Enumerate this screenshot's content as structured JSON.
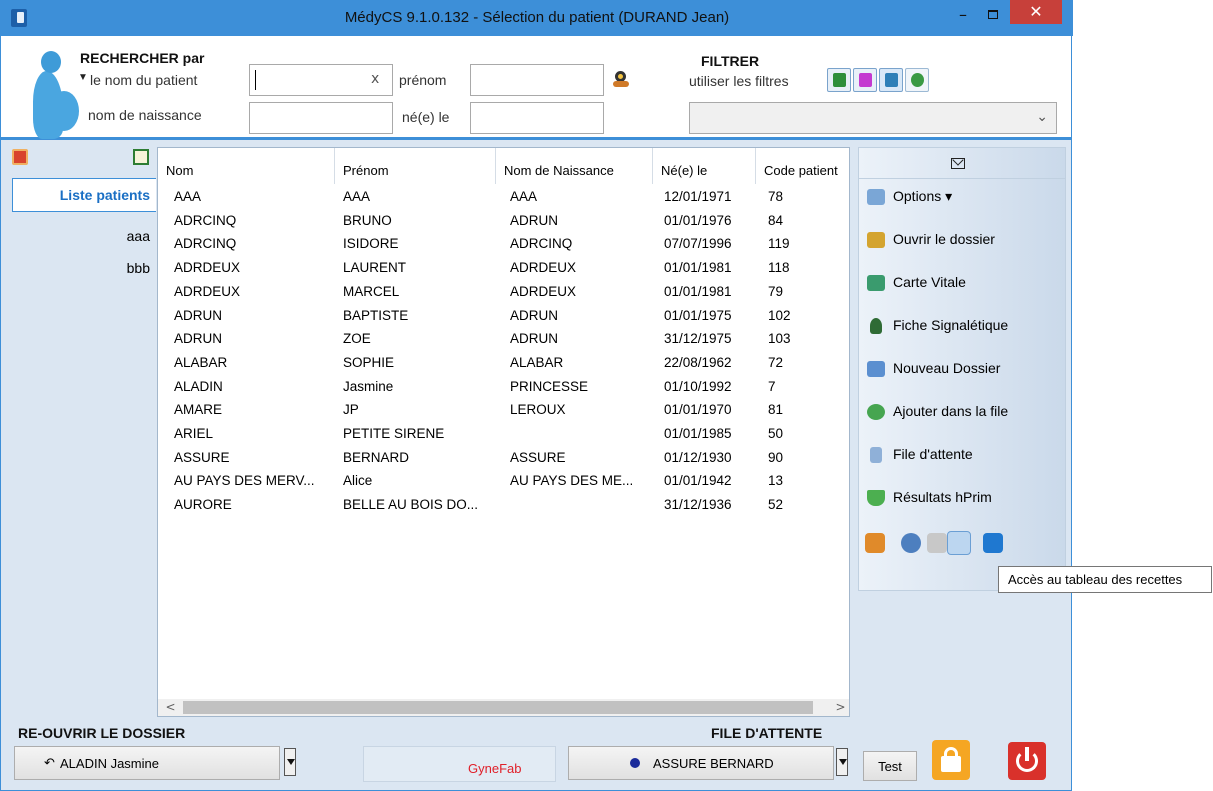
{
  "window": {
    "title": "MédyCS 9.1.0.132 - Sélection du patient (DURAND Jean)",
    "min": "–",
    "close": "✕"
  },
  "search": {
    "title": "RECHERCHER par",
    "mode": "le nom du patient",
    "clear": "x",
    "prenom_label": "prénom",
    "birthname_label": "nom de naissance",
    "born_label": "né(e) le",
    "name_value": "",
    "prenom_value": "",
    "birthname_value": "",
    "born_value": ""
  },
  "filter": {
    "title": "FILTRER",
    "subtitle": "utiliser les filtres",
    "select_value": ""
  },
  "sidebar": {
    "items": [
      {
        "label": "Liste patients"
      },
      {
        "label": "aaa"
      },
      {
        "label": "bbb"
      }
    ]
  },
  "grid": {
    "columns": [
      "Nom",
      "Prénom",
      "Nom de Naissance",
      "Né(e) le",
      "Code patient"
    ],
    "rows": [
      [
        "AAA",
        "AAA",
        "AAA",
        "12/01/1971",
        "78"
      ],
      [
        "ADRCINQ",
        "BRUNO",
        "ADRUN",
        "01/01/1976",
        "84"
      ],
      [
        "ADRCINQ",
        "ISIDORE",
        "ADRCINQ",
        "07/07/1996",
        "119"
      ],
      [
        "ADRDEUX",
        "LAURENT",
        "ADRDEUX",
        "01/01/1981",
        "118"
      ],
      [
        "ADRDEUX",
        "MARCEL",
        "ADRDEUX",
        "01/01/1981",
        "79"
      ],
      [
        "ADRUN",
        "BAPTISTE",
        "ADRUN",
        "01/01/1975",
        "102"
      ],
      [
        "ADRUN",
        "ZOE",
        "ADRUN",
        "31/12/1975",
        "103"
      ],
      [
        "ALABAR",
        "SOPHIE",
        "ALABAR",
        "22/08/1962",
        "72"
      ],
      [
        "ALADIN",
        "Jasmine",
        "PRINCESSE",
        "01/10/1992",
        "7"
      ],
      [
        "AMARE",
        "JP",
        "LEROUX",
        "01/01/1970",
        "81"
      ],
      [
        "ARIEL",
        "PETITE SIRENE",
        "",
        "01/01/1985",
        "50"
      ],
      [
        "ASSURE",
        "BERNARD",
        "ASSURE",
        "01/12/1930",
        "90"
      ],
      [
        "AU PAYS DES MERV...",
        "Alice",
        "AU PAYS DES ME...",
        "01/01/1942",
        "13"
      ],
      [
        "AURORE",
        "BELLE AU BOIS DO...",
        "",
        "31/12/1936",
        "52"
      ]
    ]
  },
  "actions": {
    "options": "Options ▾",
    "open": "Ouvrir le dossier",
    "carte_vitale": "Carte Vitale",
    "fiche": "Fiche Signalétique",
    "new_file": "Nouveau Dossier",
    "add_queue": "Ajouter dans la file",
    "queue": "File d'attente",
    "results": "Résultats hPrim"
  },
  "tooltip": "Accès au tableau des recettes",
  "bottom": {
    "reopen_title": "RE-OUVRIR LE DOSSIER",
    "reopen_value": "ALADIN Jasmine",
    "gynefab": "GyneFab",
    "queue_title": "FILE D'ATTENTE",
    "queue_value": "ASSURE BERNARD",
    "test": "Test"
  },
  "colors": {
    "accent": "#3d8fd8",
    "close": "#c7403a",
    "gynefab": "#e0202a",
    "lock": "#f5a623",
    "power": "#d9312b"
  }
}
